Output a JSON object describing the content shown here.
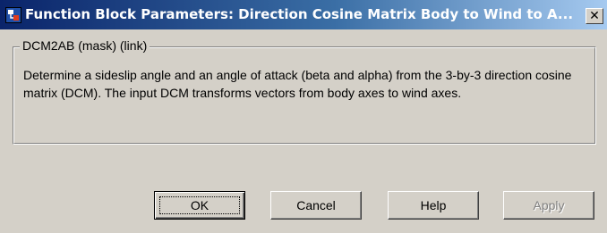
{
  "window": {
    "title": "Function Block Parameters: Direction Cosine Matrix Body to Wind to A...",
    "close_label": "✕"
  },
  "group": {
    "legend": "DCM2AB (mask) (link)",
    "description": "Determine a sideslip angle and an angle of attack (beta and alpha) from the 3-by-3 direction cosine matrix (DCM). The input DCM transforms vectors from body axes to wind axes."
  },
  "buttons": {
    "ok": "OK",
    "cancel": "Cancel",
    "help": "Help",
    "apply": "Apply"
  },
  "colors": {
    "title_start": "#0a246a",
    "title_end": "#a6caf0",
    "face": "#d4d0c8"
  }
}
